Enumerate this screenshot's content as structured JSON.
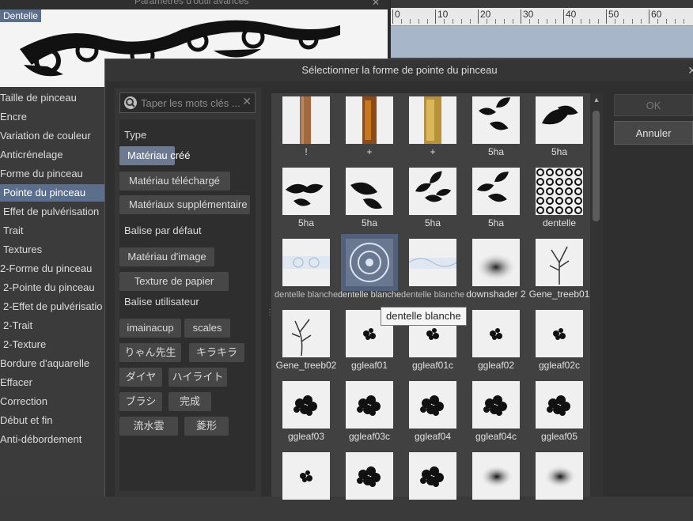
{
  "background_window": {
    "title": "Paramètres d'outil avancés",
    "preview_label": "Dentelle",
    "ruler_ticks": [
      "0",
      "10",
      "20",
      "30",
      "40",
      "50",
      "60"
    ]
  },
  "settings_list": {
    "items": [
      {
        "label": "Taille de pinceau",
        "sub": false,
        "active": false
      },
      {
        "label": "Encre",
        "sub": false,
        "active": false
      },
      {
        "label": "Variation de couleur",
        "sub": false,
        "active": false
      },
      {
        "label": "Anticrénelage",
        "sub": false,
        "active": false
      },
      {
        "label": "Forme du pinceau",
        "sub": false,
        "active": false
      },
      {
        "label": "Pointe du pinceau",
        "sub": true,
        "active": true
      },
      {
        "label": "Effet de pulvérisation",
        "sub": true,
        "active": false
      },
      {
        "label": "Trait",
        "sub": true,
        "active": false
      },
      {
        "label": "Textures",
        "sub": true,
        "active": false
      },
      {
        "label": "2-Forme du pinceau",
        "sub": false,
        "active": false
      },
      {
        "label": "2-Pointe du pinceau",
        "sub": true,
        "active": false
      },
      {
        "label": "2-Effet de pulvérisatio",
        "sub": true,
        "active": false
      },
      {
        "label": "2-Trait",
        "sub": true,
        "active": false
      },
      {
        "label": "2-Texture",
        "sub": true,
        "active": false
      },
      {
        "label": "Bordure d'aquarelle",
        "sub": false,
        "active": false
      },
      {
        "label": "Effacer",
        "sub": false,
        "active": false
      },
      {
        "label": "Correction",
        "sub": false,
        "active": false
      },
      {
        "label": "Début et fin",
        "sub": false,
        "active": false
      },
      {
        "label": "Anti-débordement",
        "sub": false,
        "active": false
      }
    ]
  },
  "dialog": {
    "title": "Sélectionner la forme de pointe du pinceau",
    "search": {
      "placeholder": "Taper les mots clés ..."
    },
    "sections": {
      "type": "Type",
      "default_tag": "Balise par défaut",
      "user_tag": "Balise utilisateur"
    },
    "type_tags": [
      "Matériau créé",
      "Matériau téléchargé",
      "Matériaux supplémentaire"
    ],
    "default_tags": [
      "Matériau d'image",
      "Texture de papier"
    ],
    "user_tags": [
      "imainacup",
      "scales",
      "りゃん先生",
      "キラキラ",
      "ダイヤ",
      "ハイライト",
      "ブラシ",
      "完成",
      "流水雲",
      "菱形"
    ],
    "ok_label": "OK",
    "cancel_label": "Annuler",
    "tooltip": "dentelle blanche",
    "materials": [
      {
        "label": "!",
        "icon": "wood-strip"
      },
      {
        "label": "+",
        "icon": "rust-strip"
      },
      {
        "label": "+",
        "icon": "gold-strip"
      },
      {
        "label": "5ha",
        "icon": "leaves-3"
      },
      {
        "label": "5ha",
        "icon": "leaves-2"
      },
      {
        "label": "5ha",
        "icon": "leaves-4"
      },
      {
        "label": "5ha",
        "icon": "leaves-2b"
      },
      {
        "label": "5ha",
        "icon": "leaves-5"
      },
      {
        "label": "5ha",
        "icon": "leaves-3b"
      },
      {
        "label": "dentelle",
        "icon": "lace-pattern"
      },
      {
        "label": "dentelle blanche",
        "icon": "white-lace"
      },
      {
        "label": "dentelle blanche",
        "icon": "white-lace-medallion"
      },
      {
        "label": "dentelle blanche",
        "icon": "white-lace-2"
      },
      {
        "label": "downshader 2",
        "icon": "soft-blob"
      },
      {
        "label": "Gene_treeb01",
        "icon": "tree-branch"
      },
      {
        "label": "Gene_treeb02",
        "icon": "tree-branch-2"
      },
      {
        "label": "ggleaf01",
        "icon": "leaf-cluster"
      },
      {
        "label": "ggleaf01c",
        "icon": "leaf-cluster"
      },
      {
        "label": "ggleaf02",
        "icon": "leaf-cluster"
      },
      {
        "label": "ggleaf02c",
        "icon": "leaf-cluster"
      },
      {
        "label": "ggleaf03",
        "icon": "leaf-cluster-large"
      },
      {
        "label": "ggleaf03c",
        "icon": "leaf-cluster-large"
      },
      {
        "label": "ggleaf04",
        "icon": "leaf-cluster-large"
      },
      {
        "label": "ggleaf04c",
        "icon": "leaf-cluster-large"
      },
      {
        "label": "ggleaf05",
        "icon": "leaf-cluster-large"
      },
      {
        "label": "",
        "icon": "leaf-cluster"
      },
      {
        "label": "",
        "icon": "leaf-cluster-large"
      },
      {
        "label": "",
        "icon": "leaf-cluster-large"
      },
      {
        "label": "",
        "icon": "soft-stroke"
      },
      {
        "label": "",
        "icon": "soft-stroke"
      }
    ]
  }
}
